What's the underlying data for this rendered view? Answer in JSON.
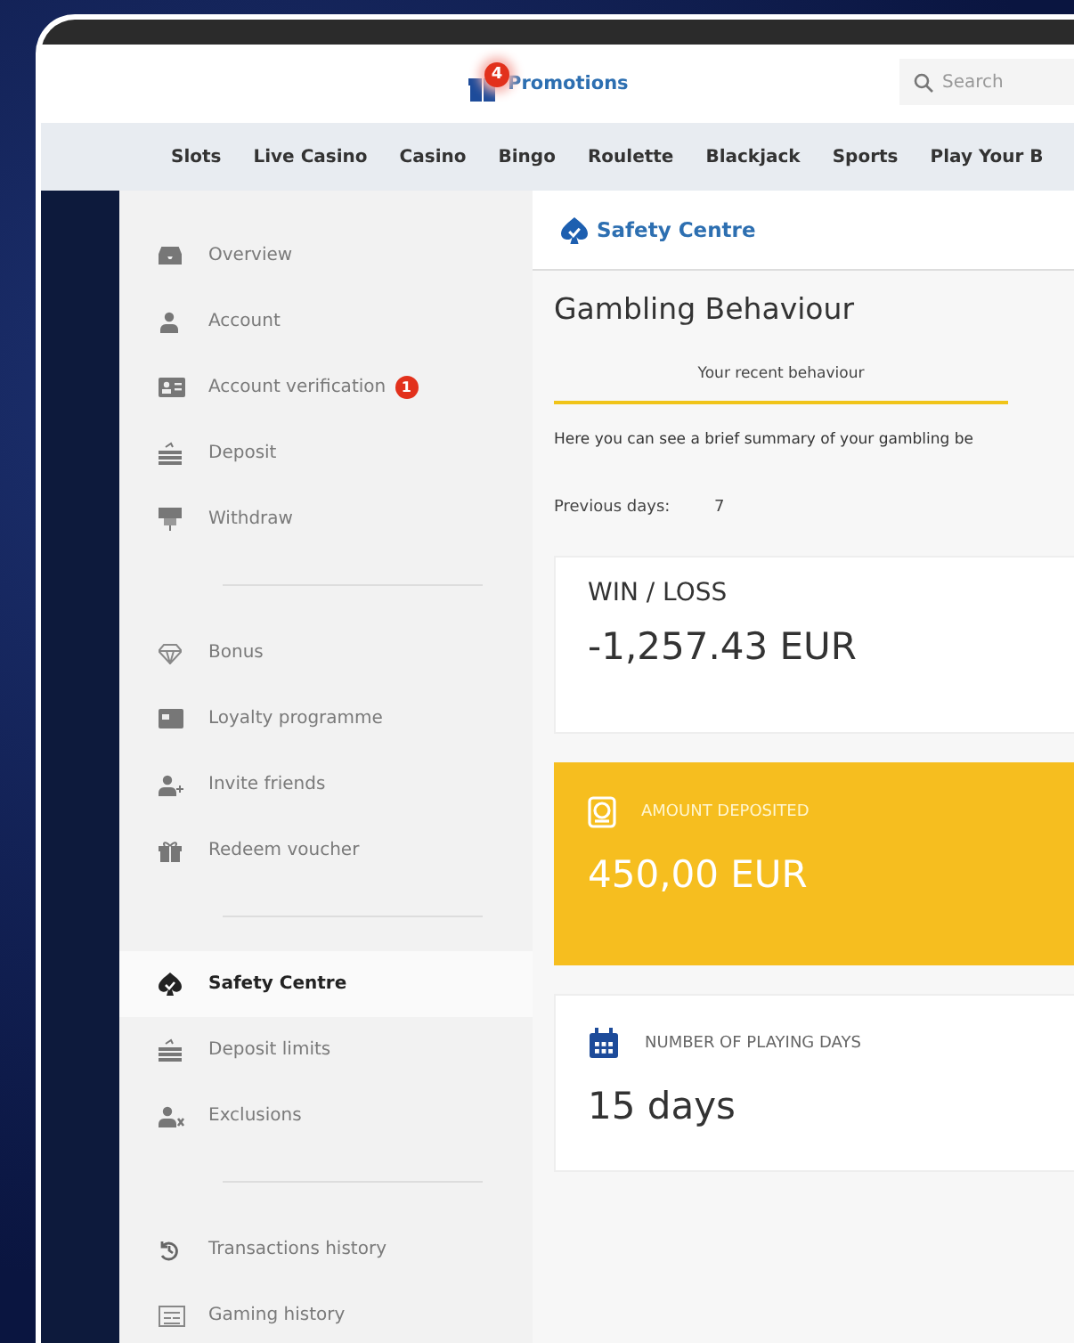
{
  "header": {
    "promotions": {
      "label": "Promotions",
      "badge": "4"
    },
    "search": {
      "placeholder": "Search"
    }
  },
  "nav": [
    {
      "label": "Slots"
    },
    {
      "label": "Live Casino"
    },
    {
      "label": "Casino"
    },
    {
      "label": "Bingo"
    },
    {
      "label": "Roulette"
    },
    {
      "label": "Blackjack"
    },
    {
      "label": "Sports"
    },
    {
      "label": "Play Your B"
    }
  ],
  "sidebar": {
    "groups": [
      [
        {
          "label": "Overview",
          "selected": false
        },
        {
          "label": "Account",
          "selected": false
        },
        {
          "label": "Account verification",
          "badge": "1",
          "selected": false
        },
        {
          "label": "Deposit",
          "selected": false
        },
        {
          "label": "Withdraw",
          "selected": false
        }
      ],
      [
        {
          "label": "Bonus",
          "selected": false
        },
        {
          "label": "Loyalty programme",
          "selected": false
        },
        {
          "label": "Invite friends",
          "selected": false
        },
        {
          "label": "Redeem voucher",
          "selected": false
        }
      ],
      [
        {
          "label": "Safety Centre",
          "selected": true
        },
        {
          "label": "Deposit limits",
          "selected": false
        },
        {
          "label": "Exclusions",
          "selected": false
        }
      ],
      [
        {
          "label": "Transactions history",
          "selected": false
        },
        {
          "label": "Gaming history",
          "selected": false
        }
      ]
    ]
  },
  "main": {
    "breadcrumb": "Safety Centre",
    "title": "Gambling Behaviour",
    "tabs": [
      {
        "label": "Your recent behaviour",
        "selected": true
      }
    ],
    "summary": "Here you can see a brief summary of your gambling be",
    "period": {
      "label": "Previous days:",
      "value": "7"
    },
    "cards": [
      {
        "kind": "plain",
        "label": "WIN / LOSS",
        "value": "-1,257.43 EUR"
      },
      {
        "kind": "highlight",
        "label": "AMOUNT DEPOSITED",
        "value": "450,00 EUR"
      },
      {
        "kind": "plain",
        "label": "NUMBER OF PLAYING DAYS",
        "value": "15 days"
      }
    ]
  }
}
